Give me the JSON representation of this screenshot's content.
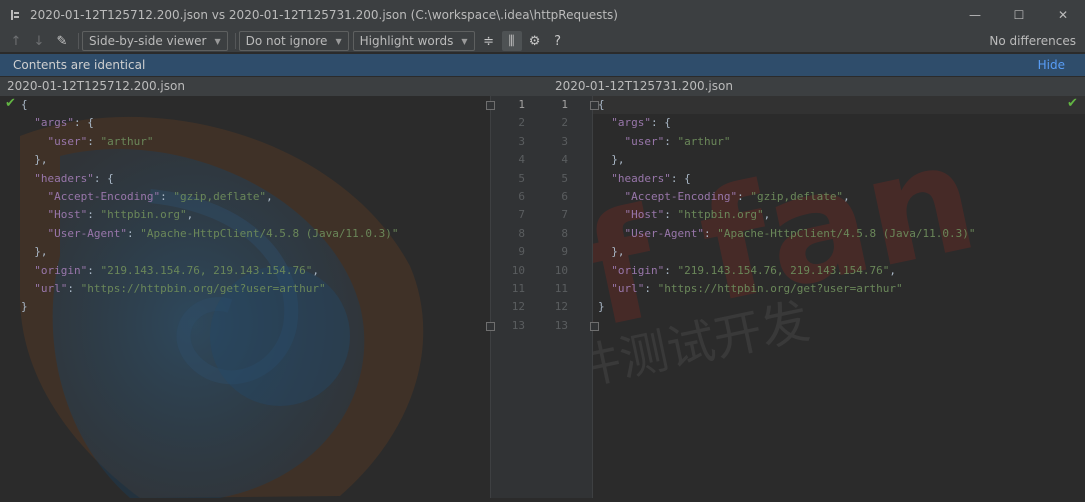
{
  "window": {
    "title": "2020-01-12T125712.200.json vs 2020-01-12T125731.200.json (C:\\workspace\\.idea\\httpRequests)",
    "controls": {
      "minimize": "—",
      "maximize": "☐",
      "close": "✕"
    }
  },
  "toolbar": {
    "prev_icon": "↑",
    "next_icon": "↓",
    "edit_icon": "✎",
    "viewer_label": "Side-by-side viewer",
    "ignore_label": "Do not ignore",
    "highlight_label": "Highlight words",
    "collapse_icon": "≑",
    "sync_icon": "⫼",
    "settings_icon": "⚙",
    "help_icon": "?",
    "status": "No differences"
  },
  "notice": {
    "text": "Contents are identical",
    "hide_label": "Hide"
  },
  "files": {
    "left": "2020-01-12T125712.200.json",
    "right": "2020-01-12T125731.200.json"
  },
  "content": {
    "lines": [
      "{",
      "  \"args\": {",
      "    \"user\": \"arthur\"",
      "  },",
      "  \"headers\": {",
      "    \"Accept-Encoding\": \"gzip,deflate\",",
      "    \"Host\": \"httpbin.org\",",
      "    \"User-Agent\": \"Apache-HttpClient/4.5.8 (Java/11.0.3)\"",
      "  },",
      "  \"origin\": \"219.143.154.76, 219.143.154.76\",",
      "  \"url\": \"https://httpbin.org/get?user=arthur\"",
      "}",
      ""
    ],
    "line_numbers": [
      "1",
      "2",
      "3",
      "4",
      "5",
      "6",
      "7",
      "8",
      "9",
      "10",
      "11",
      "12",
      "13"
    ]
  },
  "colors": {
    "key": "#9876aa",
    "string": "#6a8759",
    "punct": "#a9b7c6",
    "ok": "#62b543",
    "notice_bg": "#2f4d6b",
    "link": "#589df6"
  },
  "watermark": {
    "text": "tf fan",
    "subtitle": "软件测试开发"
  }
}
